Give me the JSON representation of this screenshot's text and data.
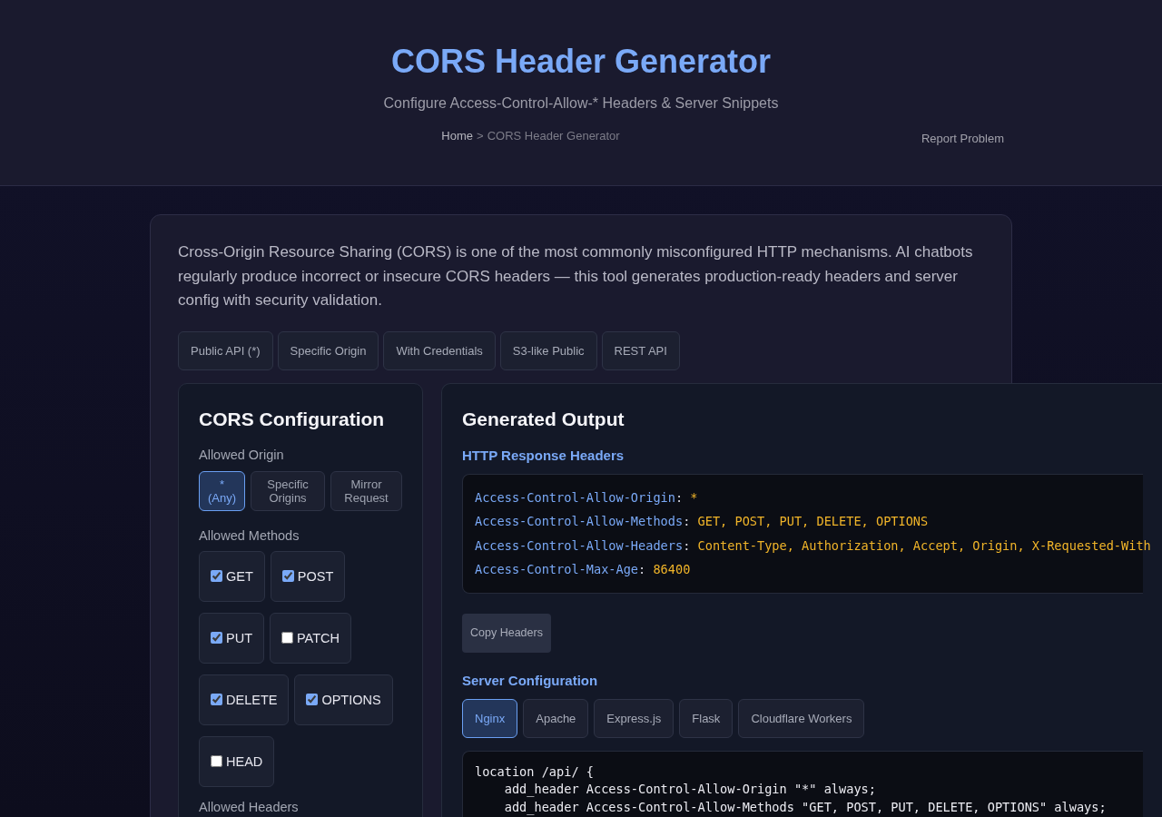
{
  "header": {
    "title": "CORS Header Generator",
    "subtitle": "Configure Access-Control-Allow-* Headers & Server Snippets",
    "breadcrumb": {
      "home": "Home",
      "separator": ">",
      "current": "CORS Header Generator"
    },
    "report_link": "Report Problem"
  },
  "intro": "Cross-Origin Resource Sharing (CORS) is one of the most commonly misconfigured HTTP mechanisms. AI chatbots regularly produce incorrect or insecure CORS headers — this tool generates production-ready headers and server config with security validation.",
  "presets": [
    "Public API (*)",
    "Specific Origin",
    "With Credentials",
    "S3-like Public",
    "REST API"
  ],
  "config_panel": {
    "title": "CORS Configuration",
    "allowed_origin": {
      "label": "Allowed Origin",
      "options": [
        {
          "label": "* (Any)",
          "selected": true
        },
        {
          "label": "Specific Origins",
          "selected": false
        },
        {
          "label": "Mirror Request",
          "selected": false
        }
      ]
    },
    "allowed_methods": {
      "label": "Allowed Methods",
      "methods": [
        {
          "label": "GET",
          "checked": true
        },
        {
          "label": "POST",
          "checked": true
        },
        {
          "label": "PUT",
          "checked": true
        },
        {
          "label": "PATCH",
          "checked": false
        },
        {
          "label": "DELETE",
          "checked": true
        },
        {
          "label": "OPTIONS",
          "checked": true
        },
        {
          "label": "HEAD",
          "checked": false
        }
      ]
    },
    "allowed_headers": {
      "label": "Allowed Headers"
    }
  },
  "output_panel": {
    "title": "Generated Output",
    "headers_section": {
      "title": "HTTP Response Headers",
      "separator": ":",
      "lines": [
        {
          "name": "Access-Control-Allow-Origin",
          "value": "*"
        },
        {
          "name": "Access-Control-Allow-Methods",
          "value": "GET, POST, PUT, DELETE, OPTIONS"
        },
        {
          "name": "Access-Control-Allow-Headers",
          "value": "Content-Type, Authorization, Accept, Origin, X-Requested-With"
        },
        {
          "name": "Access-Control-Max-Age",
          "value": "86400"
        }
      ],
      "copy_button": "Copy Headers"
    },
    "server_section": {
      "title": "Server Configuration",
      "tabs": [
        {
          "label": "Nginx",
          "selected": true
        },
        {
          "label": "Apache",
          "selected": false
        },
        {
          "label": "Express.js",
          "selected": false
        },
        {
          "label": "Flask",
          "selected": false
        },
        {
          "label": "Cloudflare Workers",
          "selected": false
        }
      ],
      "code_lines": [
        "location /api/ {",
        "    add_header Access-Control-Allow-Origin \"*\" always;",
        "    add_header Access-Control-Allow-Methods \"GET, POST, PUT, DELETE, OPTIONS\" always;"
      ]
    }
  }
}
